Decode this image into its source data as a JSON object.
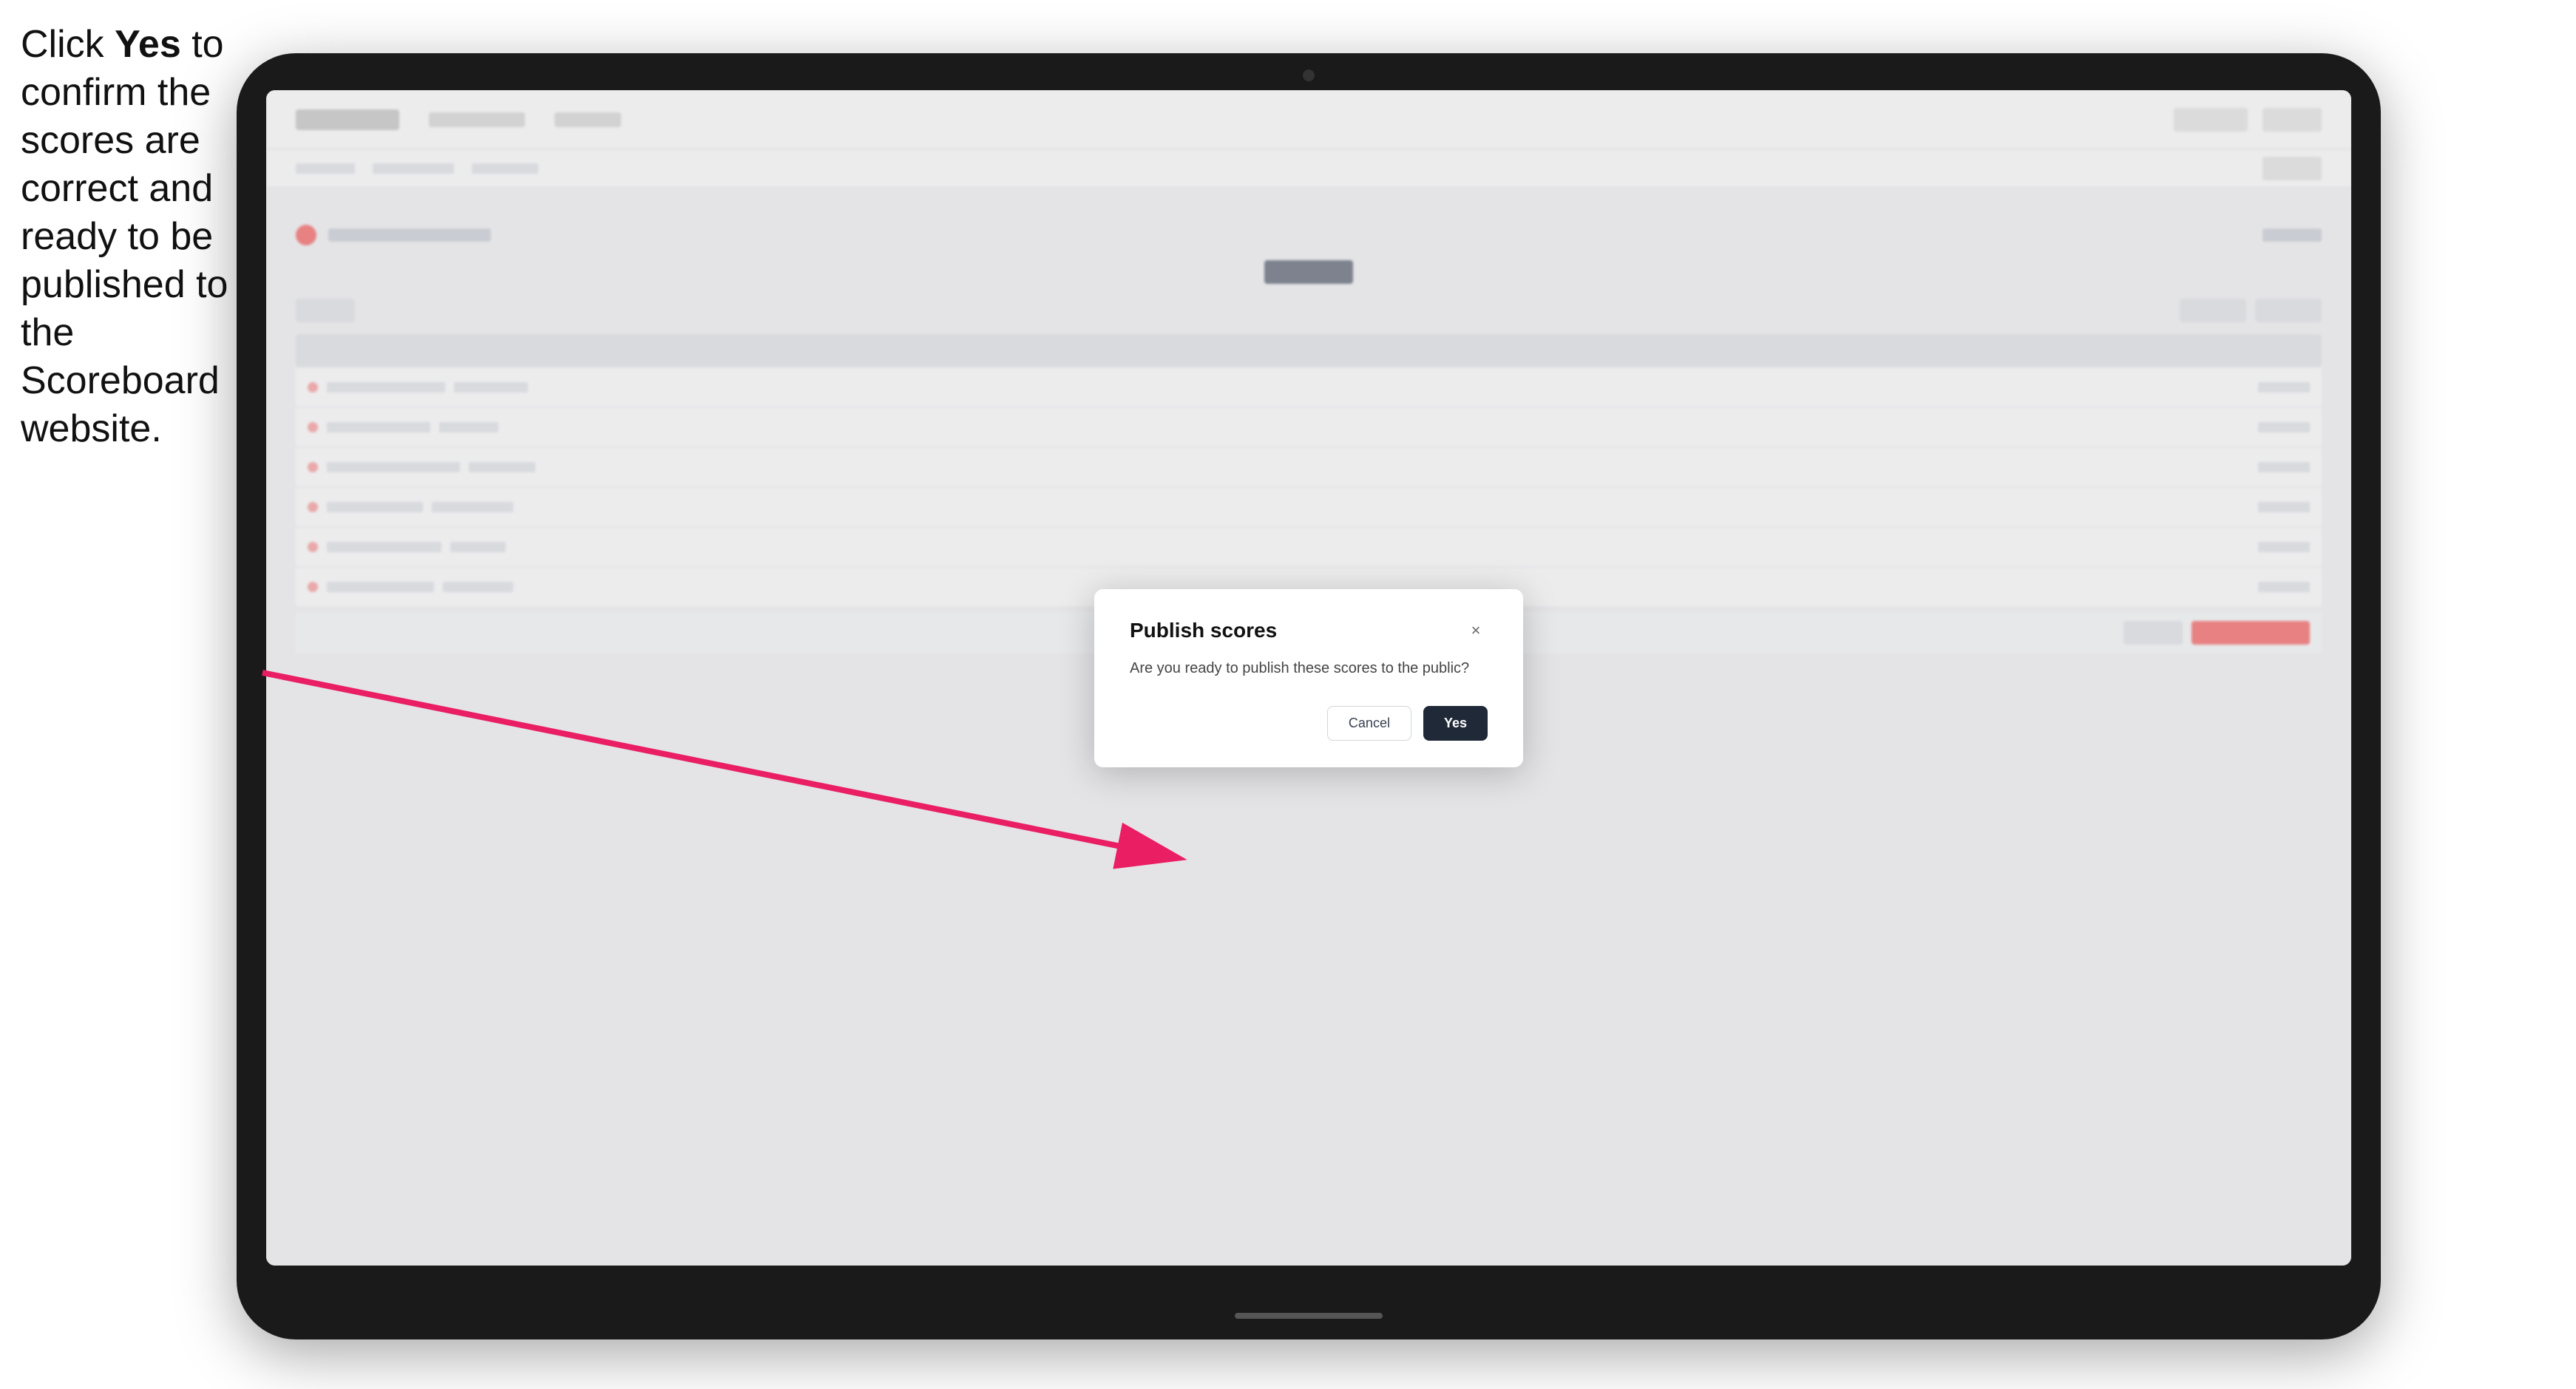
{
  "instruction": {
    "text_before_bold": "Click ",
    "bold_text": "Yes",
    "text_after": " to confirm the scores are correct and ready to be published to the Scoreboard website."
  },
  "dialog": {
    "title": "Publish scores",
    "body_text": "Are you ready to publish these scores to the public?",
    "cancel_label": "Cancel",
    "yes_label": "Yes",
    "close_icon": "×"
  },
  "app": {
    "header": {
      "logo_alt": "App Logo"
    }
  }
}
